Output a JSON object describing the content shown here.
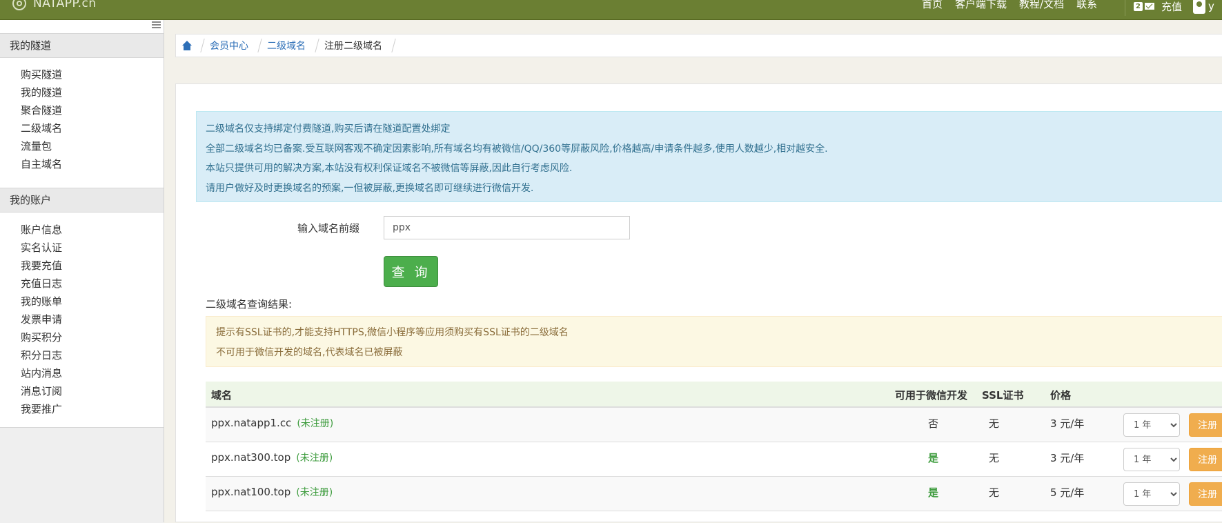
{
  "navbar": {
    "brand": "NATAPP.cn",
    "links": [
      "首页",
      "客户端下载",
      "教程/文档",
      "联系"
    ],
    "message_count": "2",
    "recharge": "充值",
    "user_initial": "y",
    "bg_color": "#6b7f33"
  },
  "sidebar": {
    "sections": [
      {
        "title": "我的隧道",
        "items": [
          "购买隧道",
          "我的隧道",
          "聚合隧道",
          "二级域名",
          "流量包",
          "自主域名"
        ]
      },
      {
        "title": "我的账户",
        "items": [
          "账户信息",
          "实名认证",
          "我要充值",
          "充值日志",
          "我的账单",
          "发票申请",
          "购买积分",
          "积分日志",
          "站内消息",
          "消息订阅",
          "我要推广"
        ]
      }
    ]
  },
  "breadcrumb": {
    "items": [
      "会员中心",
      "二级域名"
    ],
    "current": "注册二级域名"
  },
  "info_alert": [
    "二级域名仅支持绑定付费隧道,购买后请在隧道配置处绑定",
    "全部二级域名均已备案.受互联网客观不确定因素影响,所有域名均有被微信/QQ/360等屏蔽风险,价格越高/申请条件越多,使用人数越少,相对越安全.",
    "本站只提供可用的解决方案,本站没有权利保证域名不被微信等屏蔽,因此自行考虑风险.",
    "请用户做好及时更换域名的预案,一但被屏蔽,更换域名即可继续进行微信开发."
  ],
  "form": {
    "label": "输入域名前缀",
    "value": "ppx",
    "query_button": "查 询"
  },
  "result": {
    "title": "二级域名查询结果:",
    "warnings": [
      "提示有SSL证书的,才能支持HTTPS,微信小程序等应用须购买有SSL证书的二级域名",
      "不可用于微信开发的域名,代表域名已被屏蔽"
    ]
  },
  "table": {
    "headers": {
      "domain": "域名",
      "wechat": "可用于微信开发",
      "ssl": "SSL证书",
      "price": "价格"
    },
    "rows": [
      {
        "domain": "ppx.natapp1.cc",
        "status": "(未注册)",
        "wechat": "否",
        "wechat_ok": false,
        "ssl": "无",
        "price": "3 元/年",
        "period": "1 年",
        "action": "注册"
      },
      {
        "domain": "ppx.nat300.top",
        "status": "(未注册)",
        "wechat": "是",
        "wechat_ok": true,
        "ssl": "无",
        "price": "3 元/年",
        "period": "1 年",
        "action": "注册"
      },
      {
        "domain": "ppx.nat100.top",
        "status": "(未注册)",
        "wechat": "是",
        "wechat_ok": true,
        "ssl": "无",
        "price": "5 元/年",
        "period": "1 年",
        "action": "注册"
      }
    ]
  }
}
